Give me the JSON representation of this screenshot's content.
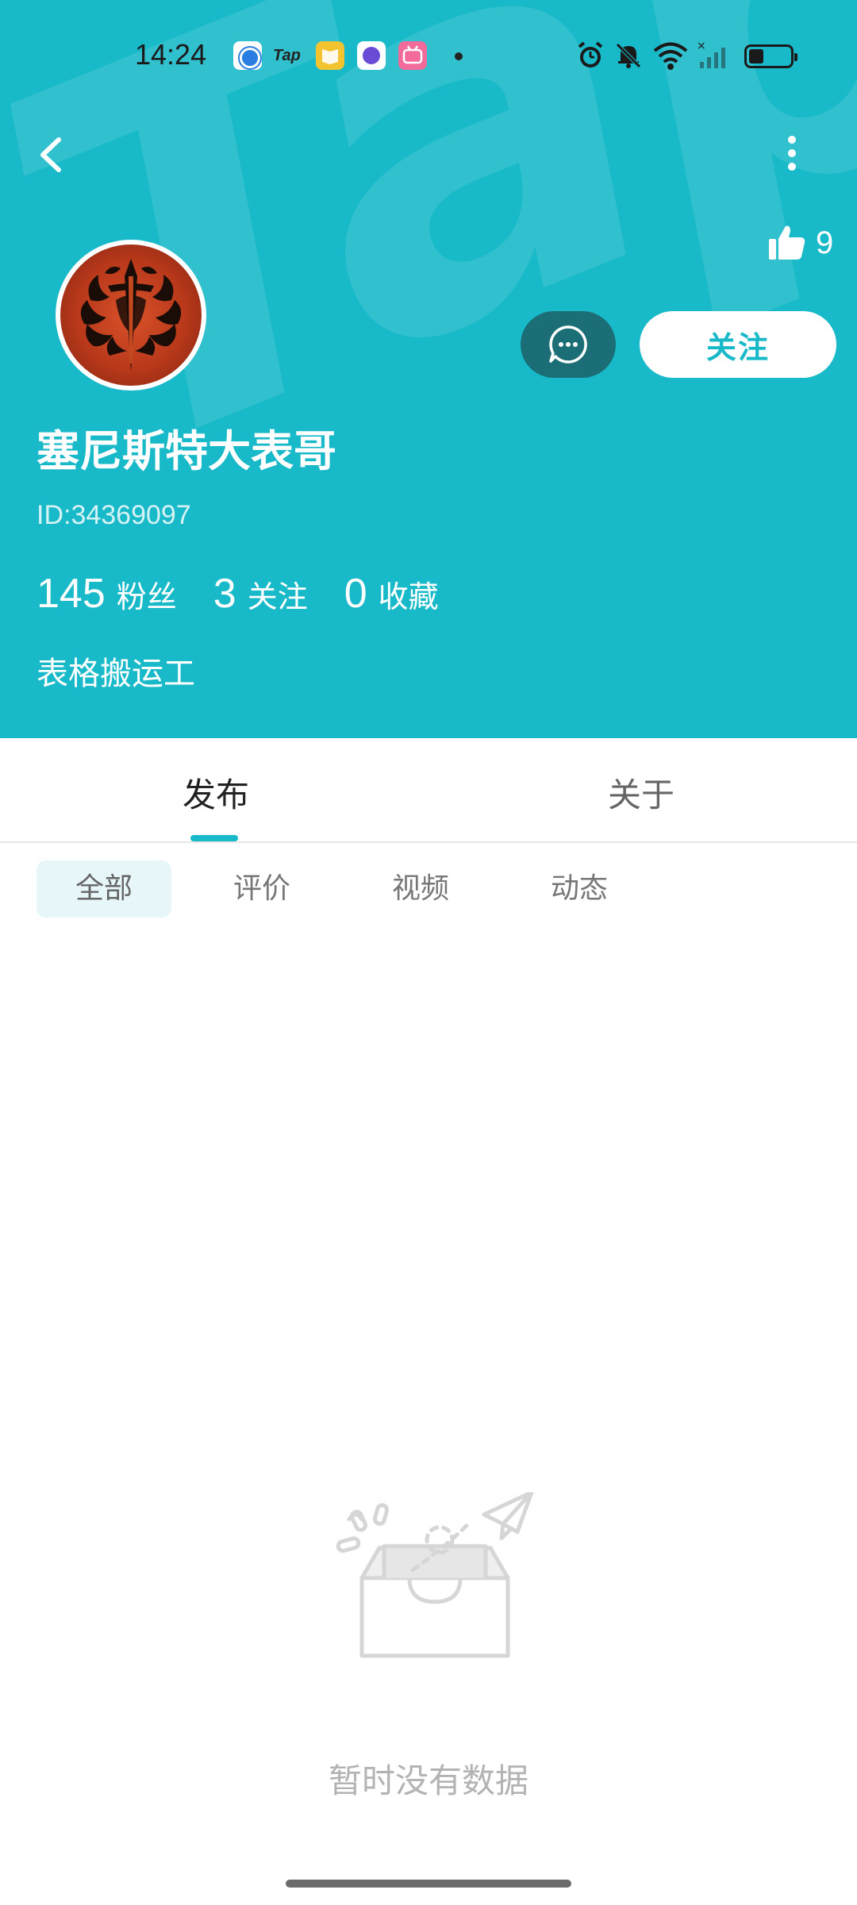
{
  "status_bar": {
    "time": "14:24",
    "notification_apps": [
      "browser-icon",
      "taptap-icon",
      "reader-icon",
      "planet-icon",
      "bilibili-icon"
    ],
    "tap_label": "Tap"
  },
  "header": {
    "background_color": "#18b9c8",
    "watermark": "TapTap"
  },
  "profile": {
    "likes": "9",
    "username": "塞尼斯特大表哥",
    "user_id": "ID:34369097",
    "follow_label": "关注",
    "stats": [
      {
        "num": "145",
        "label": "粉丝"
      },
      {
        "num": "3",
        "label": "关注"
      },
      {
        "num": "0",
        "label": "收藏"
      }
    ],
    "bio": "表格搬运工"
  },
  "tabs": {
    "publish": "发布",
    "about": "关于"
  },
  "filters": {
    "all": "全部",
    "review": "评价",
    "video": "视频",
    "moment": "动态"
  },
  "empty": {
    "text": "暂时没有数据"
  },
  "colors": {
    "accent": "#18b9c8",
    "message_button": "#1b6d76"
  }
}
